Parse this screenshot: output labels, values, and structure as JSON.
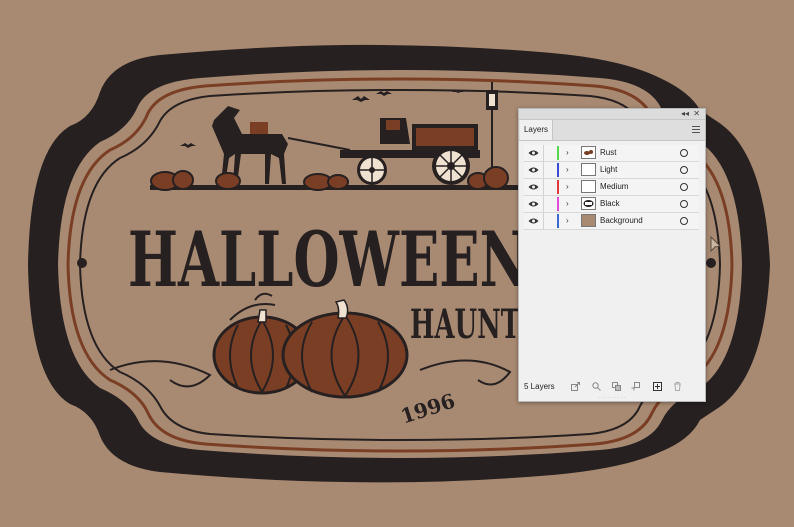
{
  "artwork": {
    "title_main": "HALLOWEEN",
    "title_sub": "HAUNT",
    "year": "1996"
  },
  "colors": {
    "background": "#a88a72",
    "rust": "#7a3e24",
    "dark": "#262021",
    "cream": "#efe2d1"
  },
  "layers_panel": {
    "tab_label": "Layers",
    "collapse_icon": "double-chevron-icon",
    "close_icon": "close-icon",
    "menu_icon": "hamburger-menu-icon",
    "layers": [
      {
        "name": "Rust",
        "color": "#52d84a"
      },
      {
        "name": "Light",
        "color": "#3a4bd6"
      },
      {
        "name": "Medium",
        "color": "#e23a3a"
      },
      {
        "name": "Black",
        "color": "#e24ad9"
      },
      {
        "name": "Background",
        "color": "#3a6ad6"
      }
    ],
    "layer_count": "5 Layers",
    "footer_icons": [
      "export-icon",
      "search-icon",
      "collect-icon",
      "release-icon",
      "new-layer-icon",
      "trash-icon"
    ]
  }
}
